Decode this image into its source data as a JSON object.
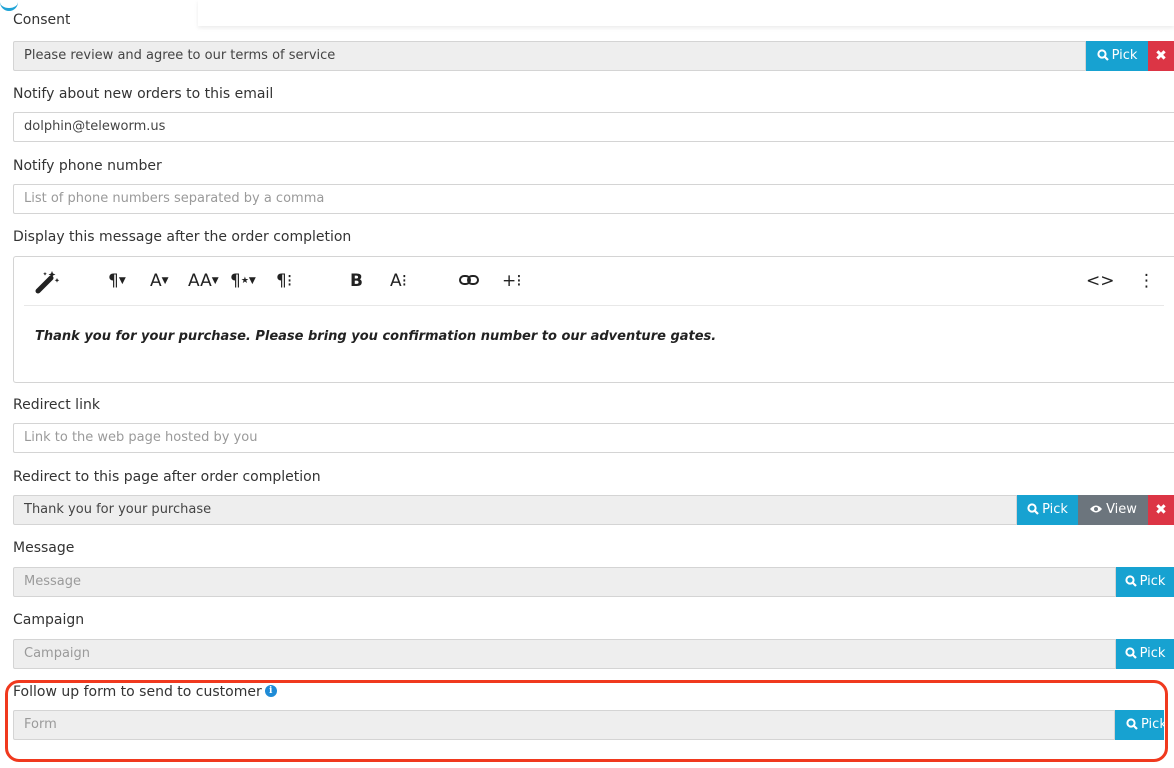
{
  "consent": {
    "label": "Consent",
    "value": "Please review and agree to our terms of service",
    "pick_label": "Pick",
    "clear_label": "✖"
  },
  "notify_email": {
    "label": "Notify about new orders to this email",
    "value": "dolphin@teleworm.us"
  },
  "notify_phone": {
    "label": "Notify phone number",
    "placeholder": "List of phone numbers separated by a comma"
  },
  "completion_message": {
    "label": "Display this message after the order completion",
    "toolbar": {
      "paragraph_format": "¶",
      "font_family": "A",
      "font_size": "AA",
      "paragraph_style": "¶",
      "more_paragraph": "¶⁝",
      "bold": "B",
      "more_text": "A⁝",
      "link": "link",
      "more_insert": "+⁝",
      "code_view": "<>",
      "more_misc": "⋮"
    },
    "content": "Thank you for your purchase. Please bring you confirmation number to our adventure gates."
  },
  "redirect_link": {
    "label": "Redirect link",
    "placeholder": "Link to the web page hosted by you"
  },
  "redirect_page": {
    "label": "Redirect to this page after order completion",
    "value": "Thank you for your purchase",
    "pick_label": "Pick",
    "view_label": "View",
    "clear_label": "✖"
  },
  "message": {
    "label": "Message",
    "placeholder": "Message",
    "pick_label": "Pick"
  },
  "campaign": {
    "label": "Campaign",
    "placeholder": "Campaign",
    "pick_label": "Pick"
  },
  "follow_up_form": {
    "label": "Follow up form to send to customer",
    "info_icon": "i",
    "placeholder": "Form",
    "pick_label": "Pick"
  },
  "colors": {
    "pick": "#17a2d1",
    "view": "#6c757d",
    "clear": "#dc3545",
    "highlight": "#f0391e",
    "info": "#1f8bd6"
  }
}
